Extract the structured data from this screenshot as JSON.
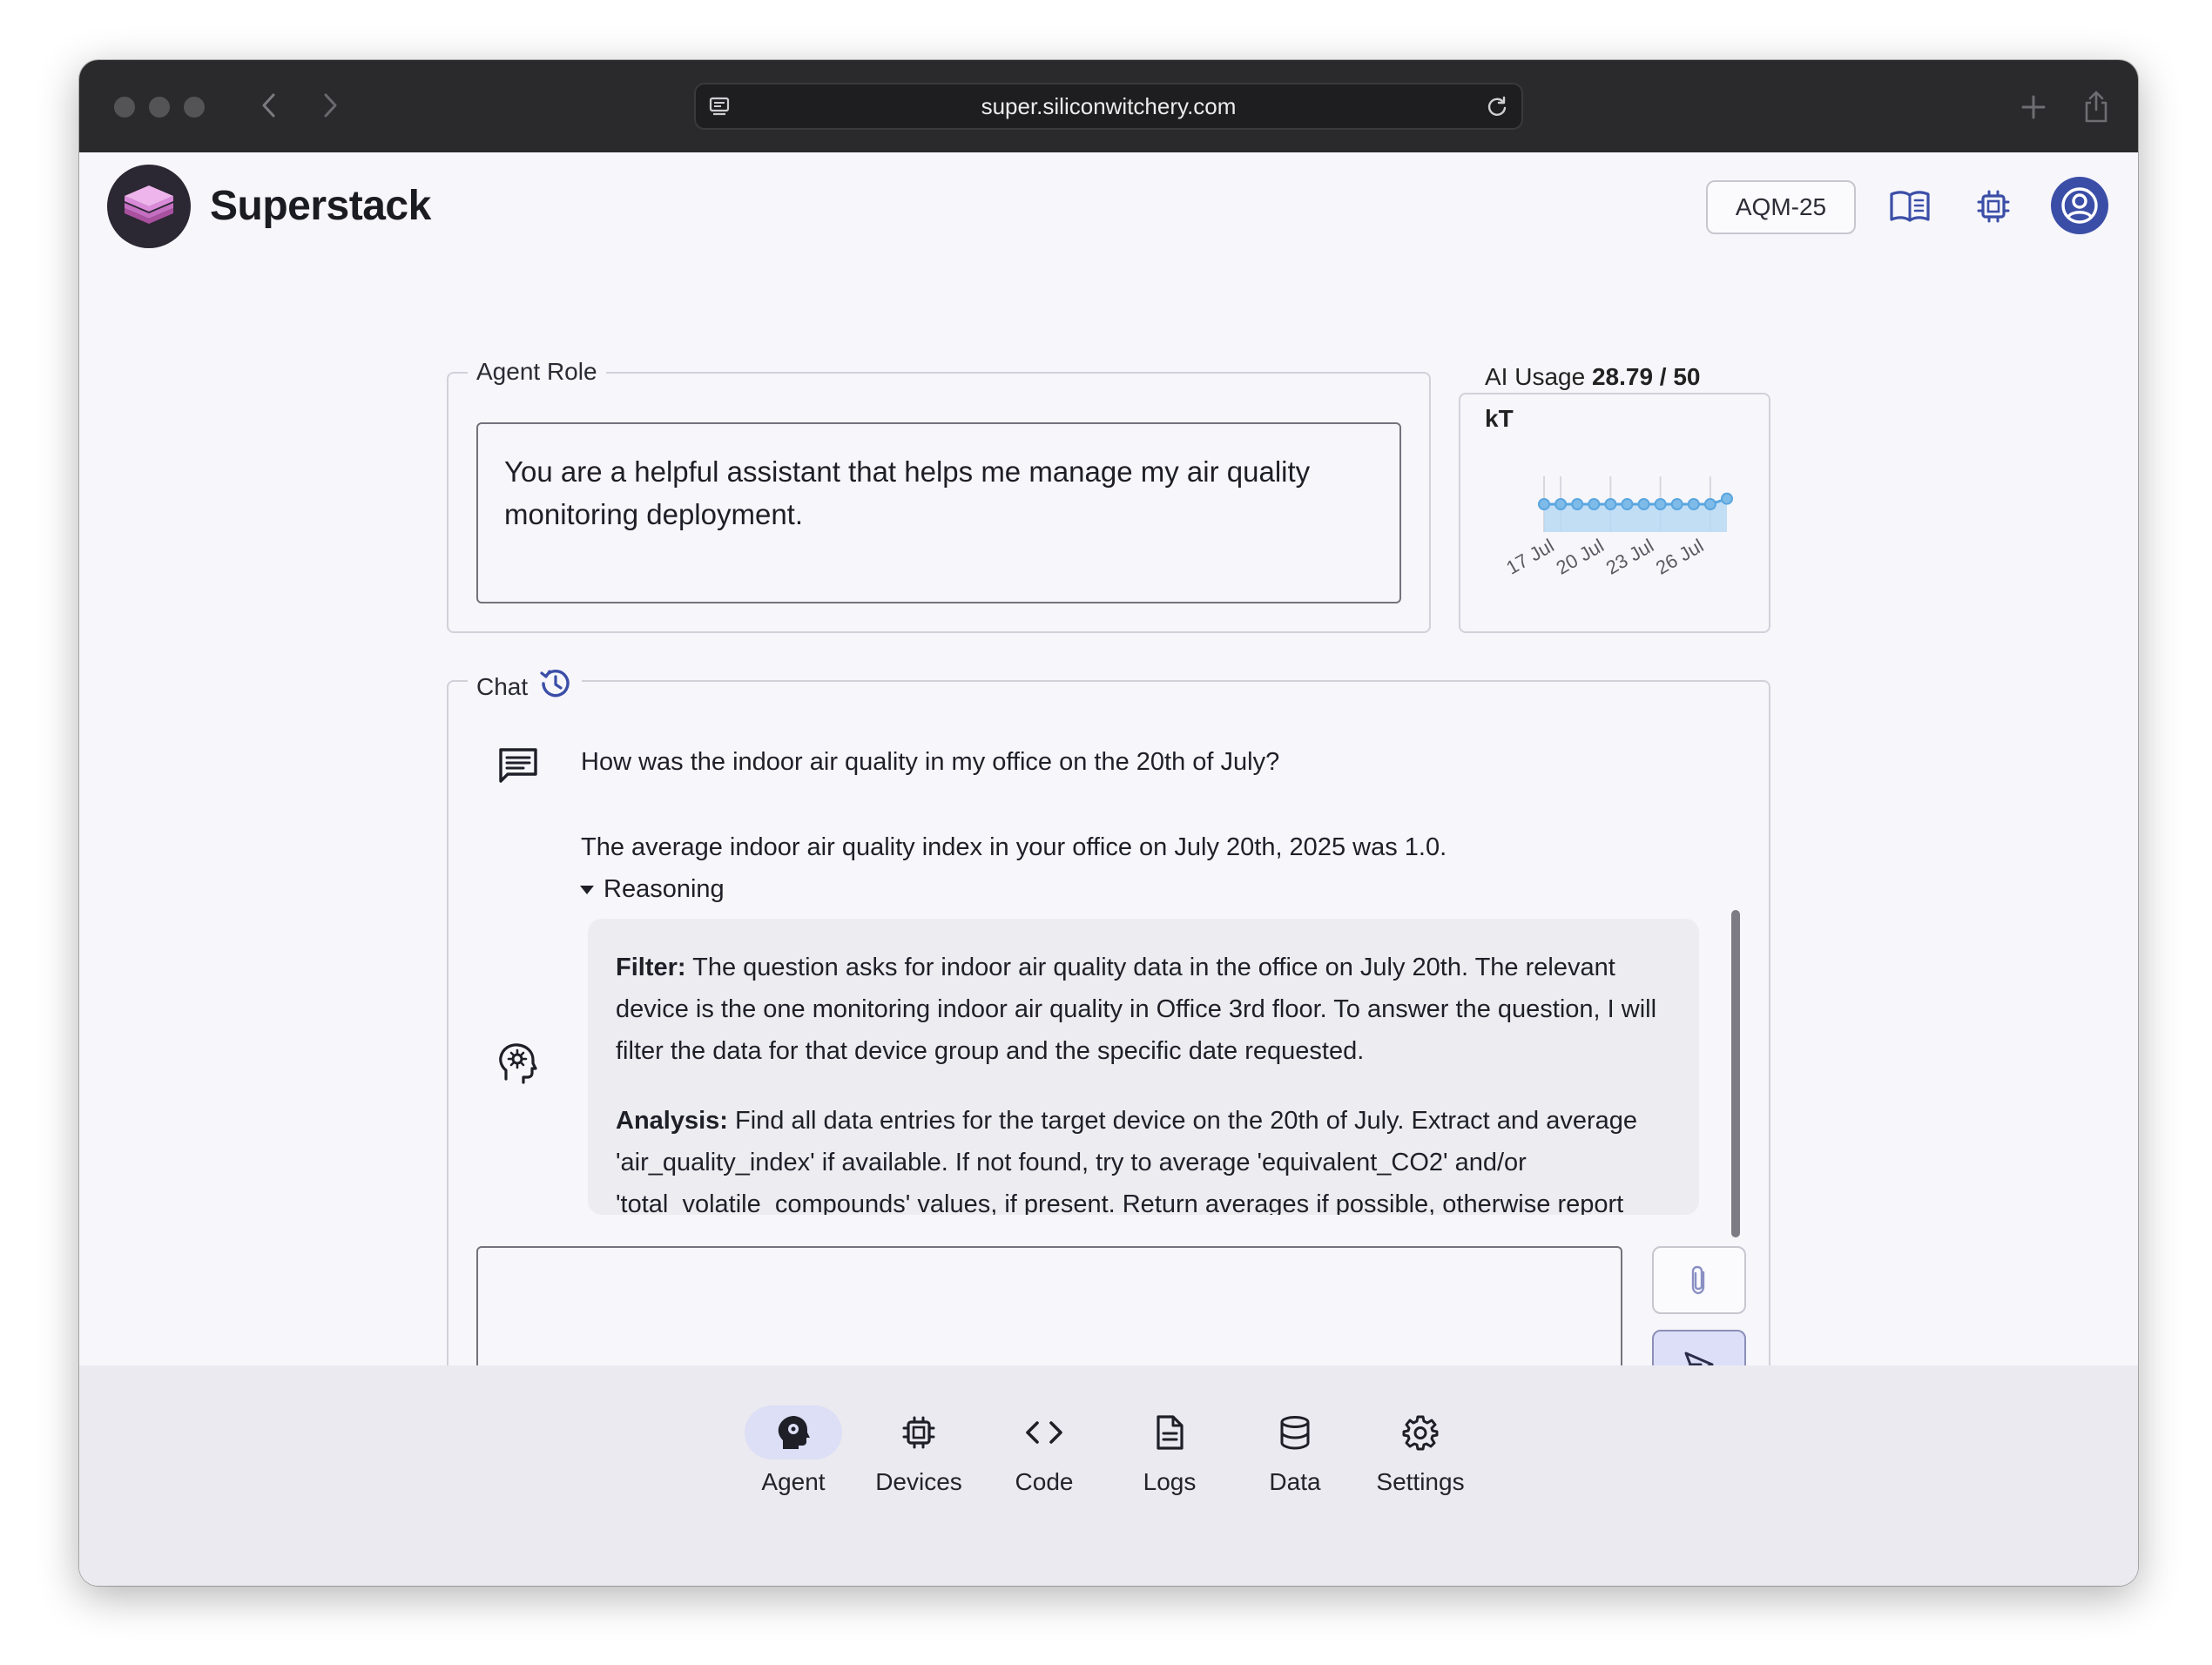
{
  "browser": {
    "url": "super.siliconwitchery.com"
  },
  "header": {
    "brand": "Superstack",
    "device_label": "AQM-25"
  },
  "agent_role": {
    "legend": "Agent Role",
    "text": "You are a helpful assistant that helps me manage my air quality monitoring deployment."
  },
  "ai_usage": {
    "label": "AI Usage",
    "value": "28.79 / 50",
    "unit": "kT"
  },
  "chart_data": {
    "type": "area",
    "x": [
      "16 Jul",
      "17 Jul",
      "18 Jul",
      "19 Jul",
      "20 Jul",
      "21 Jul",
      "22 Jul",
      "23 Jul",
      "24 Jul",
      "25 Jul",
      "26 Jul",
      "27 Jul"
    ],
    "tick_labels": [
      "17 Jul",
      "20 Jul",
      "23 Jul",
      "26 Jul"
    ],
    "values": [
      28.0,
      28.0,
      28.0,
      28.0,
      28.0,
      28.0,
      28.0,
      28.0,
      28.0,
      28.0,
      28.0,
      28.79
    ],
    "color": "#5aa6e0"
  },
  "chat": {
    "legend": "Chat",
    "user_message": "How was the indoor air quality in my office on the 20th of July?",
    "agent_answer": "The average indoor air quality index in your office on July 20th, 2025 was 1.0.",
    "reasoning_label": "Reasoning",
    "reasoning": {
      "filter_label": "Filter:",
      "filter_text": "The question asks for indoor air quality data in the office on July 20th. The relevant device is the one monitoring indoor air quality in Office 3rd floor. To answer the question, I will filter the data for that device group and the specific date requested.",
      "analysis_label": "Analysis:",
      "analysis_text": "Find all data entries for the target device on the 20th of July. Extract and average 'air_quality_index' if available. If not found, try to average 'equivalent_CO2' and/or 'total_volatile_compounds' values, if present. Return averages if possible, otherwise report"
    },
    "input_value": ""
  },
  "bottom_nav": {
    "items": [
      {
        "label": "Agent",
        "icon": "agent-head-icon",
        "active": true
      },
      {
        "label": "Devices",
        "icon": "chip-icon",
        "active": false
      },
      {
        "label": "Code",
        "icon": "code-icon",
        "active": false
      },
      {
        "label": "Logs",
        "icon": "document-icon",
        "active": false
      },
      {
        "label": "Data",
        "icon": "database-icon",
        "active": false
      },
      {
        "label": "Settings",
        "icon": "gear-icon",
        "active": false
      }
    ]
  },
  "colors": {
    "accent": "#3b4ea7",
    "brand_logo": "#d98ad8",
    "active_nav": "#dcdff5"
  }
}
